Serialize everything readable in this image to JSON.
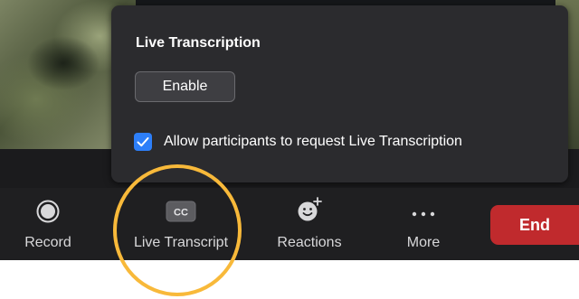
{
  "popup": {
    "title": "Live Transcription",
    "enable_label": "Enable",
    "allow_request": {
      "checked": true,
      "label": "Allow participants to request Live Transcription"
    }
  },
  "toolbar": {
    "items": [
      {
        "label": "Record",
        "icon": "record-icon"
      },
      {
        "label": "Live Transcript",
        "icon": "cc-icon",
        "icon_text": "CC"
      },
      {
        "label": "Reactions",
        "icon": "reactions-smiley-plus-icon"
      },
      {
        "label": "More",
        "icon": "more-dots-icon"
      }
    ],
    "end_label": "End"
  },
  "colors": {
    "popup_bg": "#2b2b2e",
    "toolbar_bg": "#1f1f21",
    "checkbox_blue": "#2d7ff9",
    "end_red": "#c02a2d",
    "highlight_circle": "#f8b93a"
  }
}
